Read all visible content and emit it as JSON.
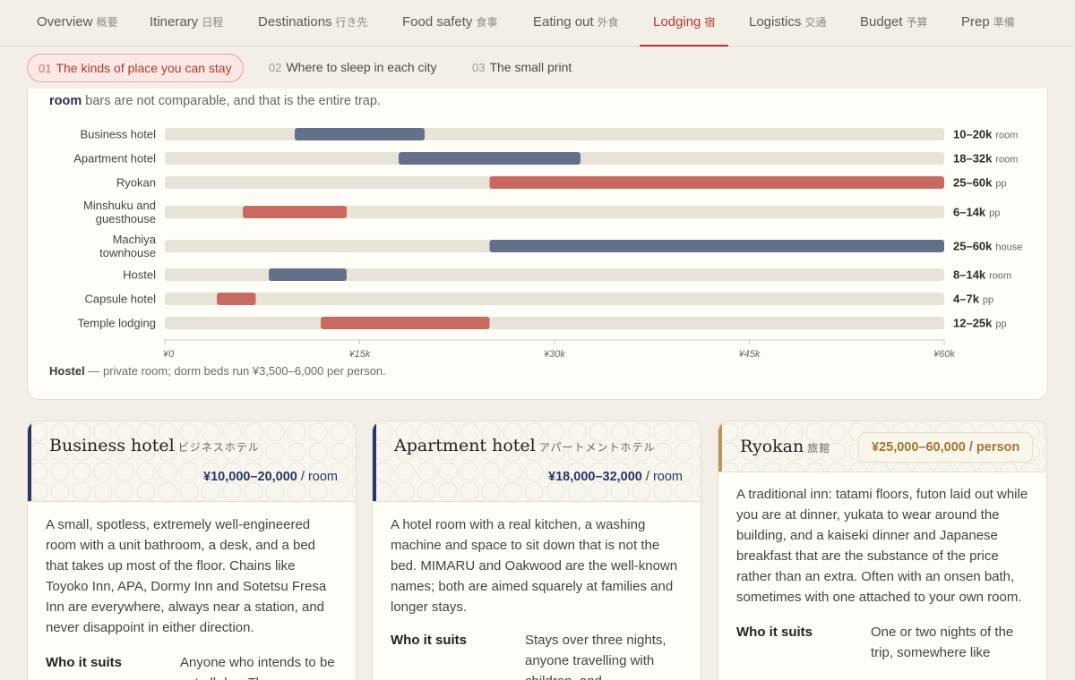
{
  "nav": {
    "tabs": [
      {
        "label": "Overview",
        "jp": "概要"
      },
      {
        "label": "Itinerary",
        "jp": "日程"
      },
      {
        "label": "Destinations",
        "jp": "行き先"
      },
      {
        "label": "Food safety",
        "jp": "食事"
      },
      {
        "label": "Eating out",
        "jp": "外食"
      },
      {
        "label": "Lodging",
        "jp": "宿"
      },
      {
        "label": "Logistics",
        "jp": "交通"
      },
      {
        "label": "Budget",
        "jp": "予算"
      },
      {
        "label": "Prep",
        "jp": "準備"
      }
    ],
    "active": "Lodging"
  },
  "subnav": {
    "items": [
      {
        "num": "01",
        "label": "The kinds of place you can stay"
      },
      {
        "num": "02",
        "label": "Where to sleep in each city"
      },
      {
        "num": "03",
        "label": "The small print"
      }
    ],
    "active": 0
  },
  "chart_intro": {
    "bold": "room",
    "rest": " bars are not comparable, and that is the entire trap."
  },
  "chart_data": {
    "type": "bar",
    "orientation": "horizontal-range",
    "categories": [
      "Business hotel",
      "Apartment hotel",
      "Ryokan",
      "Minshuku and guesthouse",
      "Machiya townhouse",
      "Hostel",
      "Capsule hotel",
      "Temple lodging"
    ],
    "category_lines": [
      [
        "Business hotel"
      ],
      [
        "Apartment hotel"
      ],
      [
        "Ryokan"
      ],
      [
        "Minshuku and",
        "guesthouse"
      ],
      [
        "Machiya",
        "townhouse"
      ],
      [
        "Hostel"
      ],
      [
        "Capsule hotel"
      ],
      [
        "Temple lodging"
      ]
    ],
    "ranges": [
      [
        10000,
        20000
      ],
      [
        18000,
        32000
      ],
      [
        25000,
        60000
      ],
      [
        6000,
        14000
      ],
      [
        25000,
        60000
      ],
      [
        8000,
        14000
      ],
      [
        4000,
        7000
      ],
      [
        12000,
        25000
      ]
    ],
    "range_labels": [
      "10–20k",
      "18–32k",
      "25–60k",
      "6–14k",
      "25–60k",
      "8–14k",
      "4–7k",
      "12–25k"
    ],
    "units": [
      "room",
      "room",
      "pp",
      "pp",
      "house",
      "room",
      "pp",
      "pp"
    ],
    "unit_colors": {
      "room": "#647089",
      "house": "#647089",
      "pp": "#c96a62"
    },
    "track_color": "#e8e3d8",
    "xlim": [
      0,
      60000
    ],
    "xticks": [
      0,
      15000,
      30000,
      45000,
      60000
    ],
    "xtick_labels": [
      "¥0",
      "¥15k",
      "¥30k",
      "¥45k",
      "¥60k"
    ]
  },
  "chart_footnote": {
    "bold": "Hostel",
    "rest": " — private room; dorm beds run ¥3,500–6,000 per person."
  },
  "cards": [
    {
      "title": "Business hotel",
      "jp": "ビジネスホテル",
      "price": "¥10,000–20,000",
      "unit": "/ room",
      "accent": "#26376a",
      "body": "A small, spotless, extremely well-engineered room with a unit bathroom, a desk, and a bed that takes up most of the floor. Chains like Toyoko Inn, APA, Dormy Inn and Sotetsu Fresa Inn are everywhere, always near a station, and never disappoint in either direction.",
      "suits_label": "Who it suits",
      "suits_value": "Anyone who intends to be out all day. The"
    },
    {
      "title": "Apartment hotel",
      "jp": "アパートメントホテル",
      "price": "¥18,000–32,000",
      "unit": "/ room",
      "accent": "#26376a",
      "body": "A hotel room with a real kitchen, a washing machine and space to sit down that is not the bed. MIMARU and Oakwood are the well-known names; both are aimed squarely at families and longer stays.",
      "suits_label": "Who it suits",
      "suits_value": "Stays over three nights, anyone travelling with children, and"
    },
    {
      "title": "Ryokan",
      "jp": "旅館",
      "price": "¥25,000–60,000 / person",
      "accent": "#b8955a",
      "body": "A traditional inn: tatami floors, futon laid out while you are at dinner, yukata to wear around the building, and a kaiseki dinner and Japanese breakfast that are the substance of the price rather than an extra. Often with an onsen bath, sometimes with one attached to your own room.",
      "suits_label": "Who it suits",
      "suits_value": "One or two nights of the trip, somewhere like"
    }
  ]
}
